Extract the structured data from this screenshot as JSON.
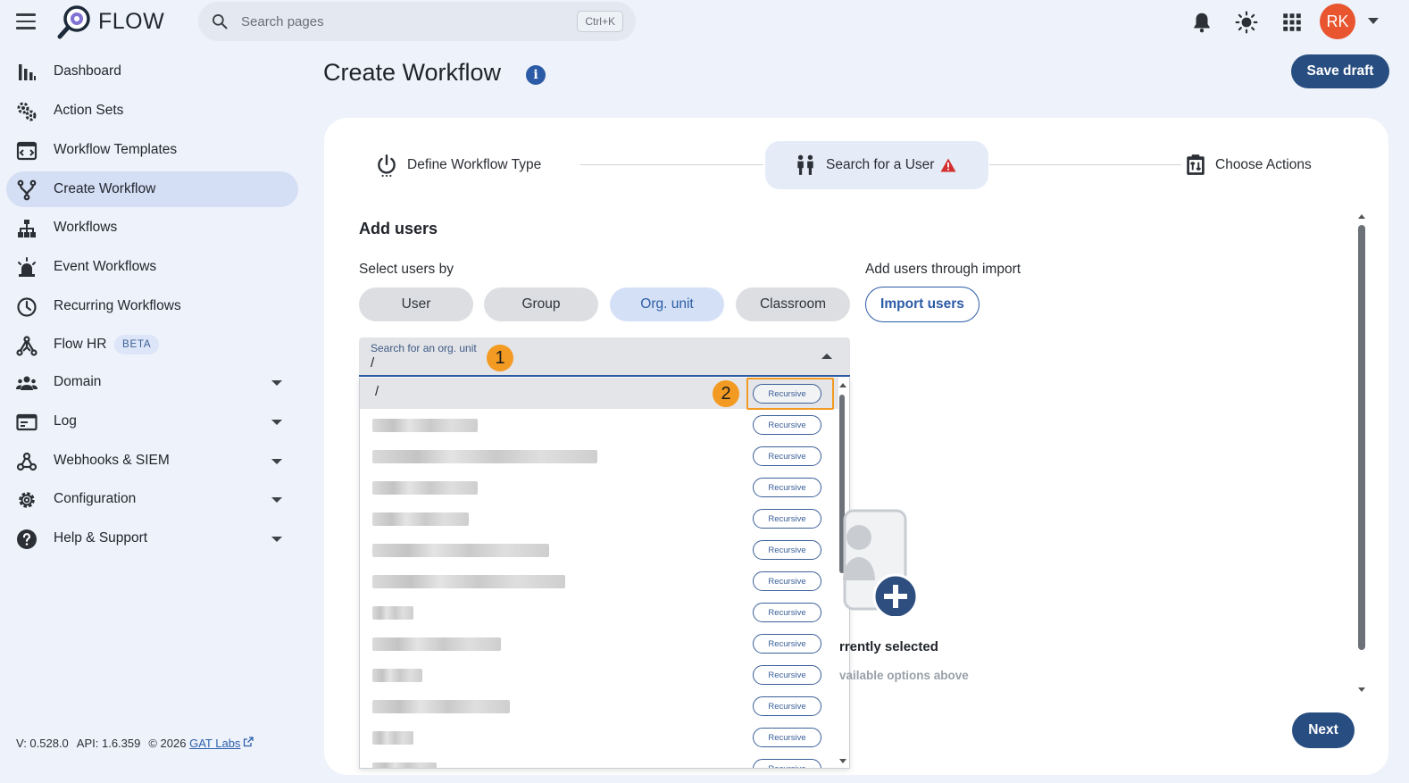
{
  "app": {
    "name": "FLOW"
  },
  "search": {
    "placeholder": "Search pages",
    "shortcut": "Ctrl+K"
  },
  "user": {
    "initials": "RK",
    "avatar_color": "#e8552f"
  },
  "sidebar": {
    "items": [
      {
        "label": "Dashboard",
        "icon": "bar-chart-icon"
      },
      {
        "label": "Action Sets",
        "icon": "gears-icon"
      },
      {
        "label": "Workflow Templates",
        "icon": "template-icon"
      },
      {
        "label": "Create Workflow",
        "icon": "fork-icon",
        "active": true
      },
      {
        "label": "Workflows",
        "icon": "hierarchy-icon"
      },
      {
        "label": "Event Workflows",
        "icon": "alarm-light-icon"
      },
      {
        "label": "Recurring Workflows",
        "icon": "clock-icon"
      },
      {
        "label": "Flow HR",
        "icon": "flow-hr-icon",
        "badge": "BETA"
      },
      {
        "label": "Domain",
        "icon": "people-icon",
        "expandable": true
      },
      {
        "label": "Log",
        "icon": "log-card-icon",
        "expandable": true
      },
      {
        "label": "Webhooks & SIEM",
        "icon": "webhook-icon",
        "expandable": true
      },
      {
        "label": "Configuration",
        "icon": "gear-icon",
        "expandable": true
      },
      {
        "label": "Help & Support",
        "icon": "help-icon",
        "expandable": true
      }
    ]
  },
  "footer": {
    "version": "V: 0.528.0",
    "api": "API: 1.6.359",
    "copyright": "© 2026",
    "link": "GAT Labs"
  },
  "main": {
    "title": "Create Workflow",
    "save_draft": "Save draft",
    "next": "Next",
    "steps": [
      {
        "label": "Define Workflow Type",
        "icon": "power-icon"
      },
      {
        "label": "Search for a User",
        "icon": "users-icon",
        "active": true,
        "warning": true
      },
      {
        "label": "Choose Actions",
        "icon": "clipboard-icon"
      }
    ],
    "add_users_heading": "Add users",
    "select_by_label": "Select users by",
    "import_label": "Add users through import",
    "import_button": "Import users",
    "select_options": [
      "User",
      "Group",
      "Org. unit",
      "Classroom"
    ],
    "selected_option": "Org. unit",
    "org_search": {
      "label": "Search for an org. unit",
      "value": "/"
    },
    "org_units": [
      {
        "name": "/",
        "highlighted": true,
        "recursive": "Recursive"
      },
      {
        "name": "",
        "blur_width": 118,
        "recursive": "Recursive"
      },
      {
        "name": "",
        "blur_width": 252,
        "recursive": "Recursive"
      },
      {
        "name": "",
        "blur_width": 118,
        "recursive": "Recursive"
      },
      {
        "name": "",
        "blur_width": 108,
        "recursive": "Recursive"
      },
      {
        "name": "",
        "blur_width": 198,
        "recursive": "Recursive"
      },
      {
        "name": "",
        "blur_width": 216,
        "recursive": "Recursive"
      },
      {
        "name": "",
        "blur_width": 46,
        "recursive": "Recursive"
      },
      {
        "name": "",
        "blur_width": 144,
        "recursive": "Recursive"
      },
      {
        "name": "",
        "blur_width": 56,
        "recursive": "Recursive"
      },
      {
        "name": "",
        "blur_width": 154,
        "recursive": "Recursive"
      },
      {
        "name": "",
        "blur_width": 46,
        "recursive": "Recursive"
      },
      {
        "name": "",
        "blur_width": 72,
        "recursive": "Recursive"
      }
    ],
    "annotations": [
      "1",
      "2"
    ],
    "empty_state": {
      "title": "rrently selected",
      "subtitle": "vailable options above"
    }
  },
  "colors": {
    "primary": "#284d80",
    "accent_orange": "#f39a22",
    "active_nav": "#d4def4",
    "warning": "#d32f2f"
  }
}
